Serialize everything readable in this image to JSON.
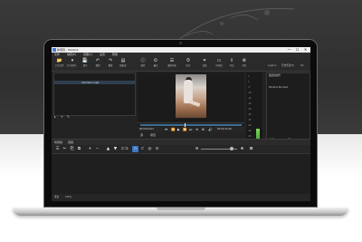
{
  "window": {
    "title": "新项目 - Shotcut",
    "controls": [
      "—",
      "☐",
      "✕"
    ]
  },
  "menubar": [
    "文件",
    "编辑(E)",
    "视图(V)",
    "设置",
    "帮助"
  ],
  "toolbar": [
    {
      "icon": "open-folder-icon",
      "glyph": "📂",
      "label": "打开文件"
    },
    {
      "icon": "open-other-icon",
      "glyph": "▾",
      "label": "打开其他..."
    },
    {
      "icon": "save-icon",
      "glyph": "💾",
      "label": "保存"
    },
    {
      "icon": "undo-icon",
      "glyph": "↶",
      "label": "撤销"
    },
    {
      "icon": "redo-icon",
      "glyph": "↷",
      "label": "重做"
    },
    {
      "icon": "peak-meter-icon",
      "glyph": "▤",
      "label": "峰值表"
    },
    {
      "icon": "properties-icon",
      "glyph": "ⓘ",
      "label": "属性"
    },
    {
      "icon": "recent-icon",
      "glyph": "⏲",
      "label": "最近"
    },
    {
      "icon": "playlist-icon",
      "glyph": "☰",
      "label": "播放列表"
    },
    {
      "icon": "history-icon",
      "glyph": "⏱",
      "label": "历史"
    },
    {
      "icon": "filters-icon",
      "glyph": "⏷",
      "label": "滤镜"
    },
    {
      "icon": "timeline-icon",
      "glyph": "▭",
      "label": "时间线"
    },
    {
      "icon": "export-icon",
      "glyph": "⇪",
      "label": "导出"
    },
    {
      "icon": "jobs-icon",
      "glyph": "⚙",
      "label": "任务"
    }
  ],
  "right_tabs": [
    "Logline",
    "开始条目(E)",
    "SO"
  ],
  "playlist": {
    "selected_item": "xlenderx.mp4",
    "buttons": [
      "▸",
      "+",
      "✎"
    ]
  },
  "transport": {
    "timecode_left": "00:00:04:03",
    "timecode_right": "00:00:11:00",
    "buttons": [
      "⏮",
      "⏪",
      "▶",
      "⏩",
      "⏭",
      "⟲",
      "⊞",
      "🔊"
    ]
  },
  "source_tabs": [
    "源",
    "项目"
  ],
  "meter_scale": [
    "3",
    "0",
    "-5",
    "-10",
    "-15",
    "-20",
    "-25",
    "-30",
    "-35",
    "-40",
    "-45",
    "-50"
  ],
  "right_panel": {
    "header": "最近的文件",
    "file": "Shotcut No.mp4",
    "bottom_tabs": [
      "最近",
      "历史"
    ]
  },
  "timeline": {
    "header_items": [
      "时间线",
      "音频"
    ],
    "tools": [
      "☰",
      "✂",
      "⎘",
      "⧉",
      "+",
      "−",
      "▲",
      "▼",
      "⊏⊐",
      "∩",
      "⊂",
      "◎",
      "⊙",
      "⊖",
      "⊕",
      "⊠"
    ],
    "zoom_level_fraction": 0.85
  },
  "status": {
    "label_left": "键盘",
    "label_right": "100%"
  }
}
